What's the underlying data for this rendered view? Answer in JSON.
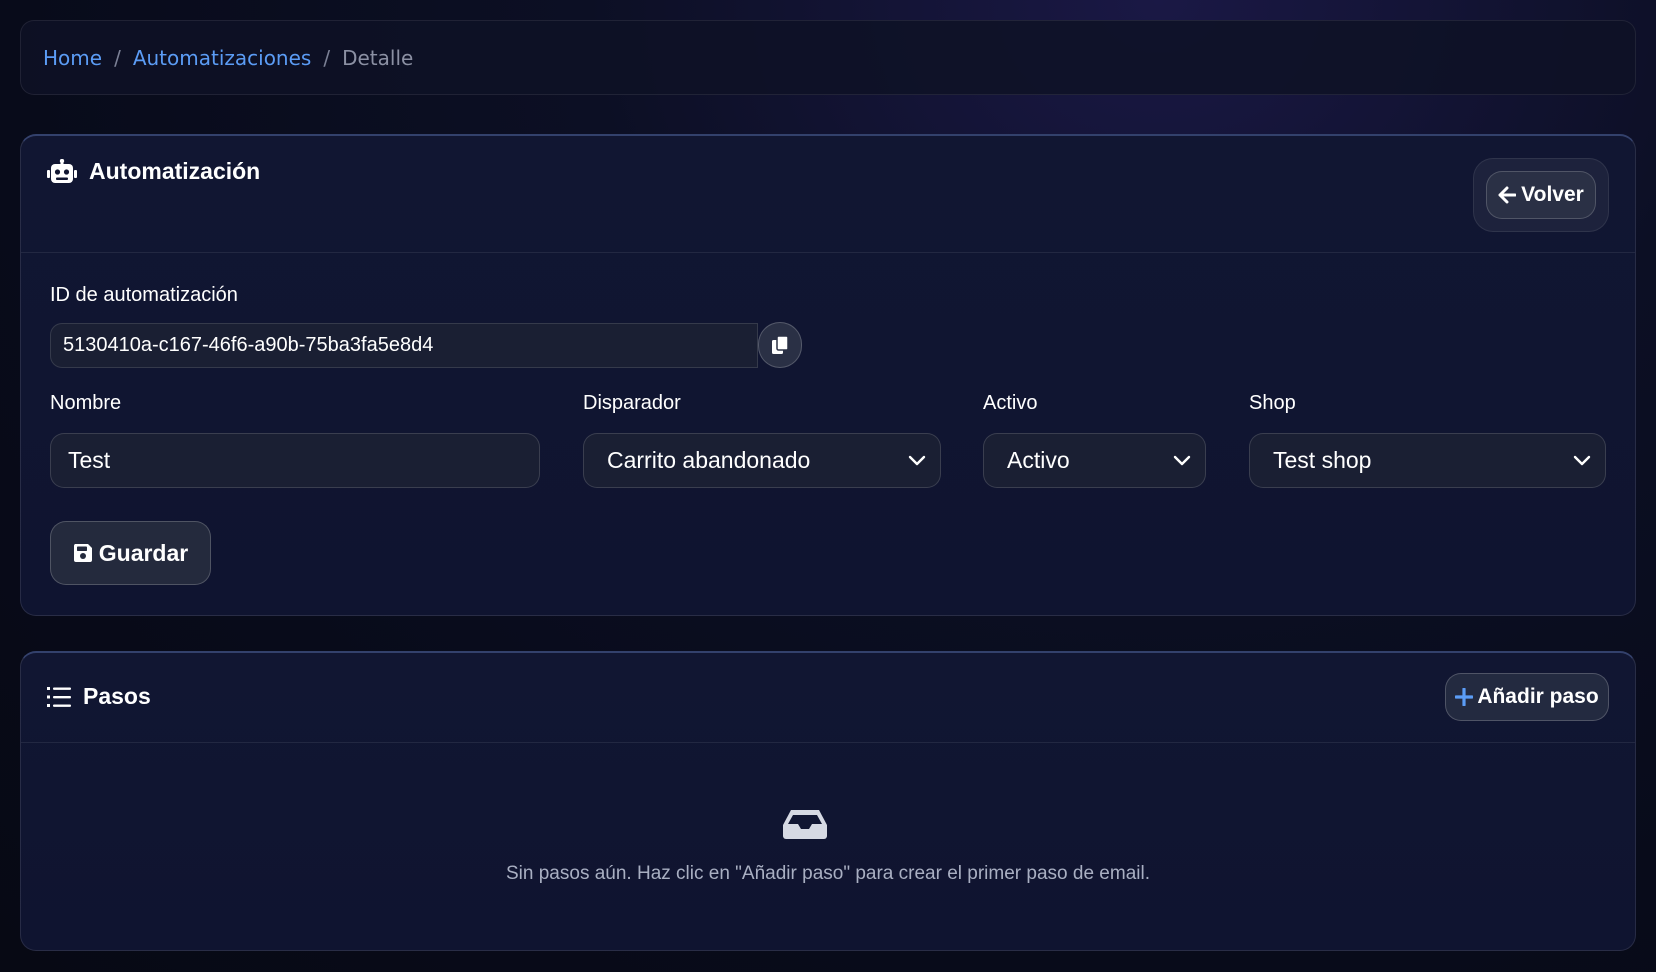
{
  "breadcrumb": {
    "items": [
      {
        "label": "Home"
      },
      {
        "label": "Automatizaciones"
      },
      {
        "label": "Detalle"
      }
    ],
    "separator": "/"
  },
  "automation_card": {
    "title": "Automatización",
    "title_icon": "robot-icon",
    "back_button": {
      "label": "Volver",
      "icon": "arrow-left-icon"
    },
    "id_field": {
      "label": "ID de automatización",
      "value": "5130410a-c167-46f6-a90b-75ba3fa5e8d4",
      "copy_icon": "copy-icon"
    },
    "name_field": {
      "label": "Nombre",
      "value": "Test"
    },
    "trigger_field": {
      "label": "Disparador",
      "value": "Carrito abandonado"
    },
    "active_field": {
      "label": "Activo",
      "value": "Activo"
    },
    "shop_field": {
      "label": "Shop",
      "value": "Test shop"
    },
    "save_button": {
      "label": "Guardar",
      "icon": "save-icon"
    }
  },
  "steps_card": {
    "title": "Pasos",
    "title_icon": "list-icon",
    "add_button": {
      "label": "Añadir paso",
      "icon": "plus-icon"
    },
    "empty_icon": "inbox-icon",
    "empty_message": "Sin pasos aún. Haz clic en \"Añadir paso\" para crear el primer paso de email."
  },
  "colors": {
    "link": "#5b9cf5",
    "card_bg": "#111632",
    "input_bg": "#1a1f33"
  }
}
